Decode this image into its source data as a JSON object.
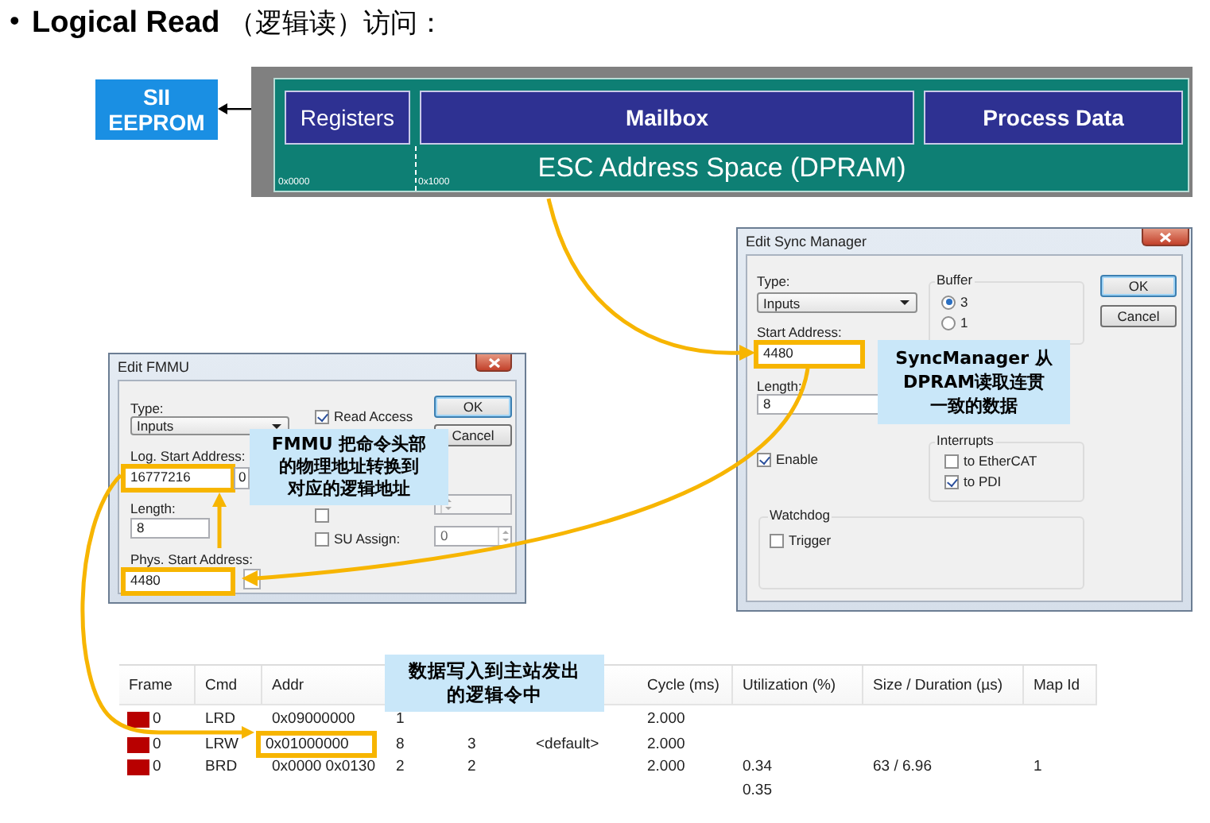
{
  "heading": {
    "bullet": "•",
    "text": "**Logical Read** （逻辑读）访问："
  },
  "memory_map": {
    "eeprom": "SII\nEEPROM",
    "blocks": [
      {
        "label": "Registers",
        "bold": false
      },
      {
        "label": "Mailbox",
        "bold": true
      },
      {
        "label": "Process Data",
        "bold": true
      }
    ],
    "space_label": "ESC Address Space (DPRAM)",
    "addresses": [
      "0x0000",
      "0x1000"
    ]
  },
  "sync_manager_dialog": {
    "title": "Edit Sync Manager",
    "type": {
      "label": "Type:",
      "value": "Inputs"
    },
    "start_address": {
      "label": "Start Address:",
      "value": "4480",
      "highlighted": true
    },
    "length": {
      "label": "Length:",
      "value": "8",
      "highlighted": false
    },
    "enable": {
      "label": "Enable",
      "checked": true
    },
    "buffer": {
      "legend": "Buffer",
      "options": [
        {
          "label": "3",
          "selected": true
        },
        {
          "label": "1",
          "selected": false
        }
      ]
    },
    "interrupts": {
      "legend": "Interrupts",
      "options": [
        {
          "label": "to EtherCAT",
          "checked": false
        },
        {
          "label": "to PDI",
          "checked": true
        }
      ]
    },
    "watchdog": {
      "legend": "Watchdog",
      "options": [
        {
          "label": "Trigger",
          "checked": false
        }
      ]
    },
    "buttons": [
      "OK",
      "Cancel"
    ],
    "callout": [
      "SyncManager 从",
      "DPRAM读取连贯",
      "一致的数据"
    ]
  },
  "fmmu_dialog": {
    "title": "Edit FMMU",
    "type": {
      "label": "Type:",
      "value": "Inputs"
    },
    "read_access": {
      "label": "Read Access",
      "checked": true
    },
    "log_start_address": {
      "label": "Log. Start Address:",
      "value": "16777216",
      "highlighted": true,
      "bit": "0"
    },
    "length": {
      "label": "Length:",
      "value": "8",
      "highlighted": false
    },
    "covered_option": {
      "checked": false
    },
    "su_assign": {
      "label": "SU Assign:",
      "checked": false,
      "value": "0"
    },
    "phys_start_address": {
      "label": "Phys. Start Address:",
      "value": "4480",
      "highlighted": true
    },
    "buttons": [
      "OK",
      "Cancel"
    ],
    "callout": [
      "FMMU 把命令头部",
      "的物理地址转换到",
      "对应的逻辑地址"
    ]
  },
  "command_table": {
    "columns": [
      "Frame",
      "Cmd",
      "Addr",
      null,
      null,
      null,
      "Cycle (ms)",
      "Utilization (%)",
      "Size / Duration (µs)",
      "Map Id"
    ],
    "rows": [
      {
        "cells": [
          "0",
          "LRD",
          {
            "text": "0x09000000",
            "highlighted": false
          },
          "1",
          null,
          null,
          "2.000",
          null,
          null,
          null
        ]
      },
      {
        "cells": [
          "0",
          "LRW",
          {
            "text": "0x01000000",
            "highlighted": true
          },
          "8",
          "3",
          "<default>",
          "2.000",
          null,
          null,
          null
        ]
      },
      {
        "cells": [
          "0",
          "BRD",
          {
            "text": "0x0000 0x0130",
            "highlighted": false
          },
          "2",
          "2",
          null,
          "2.000",
          "0.34",
          "63 / 6.96",
          "1"
        ]
      },
      {
        "cells": [
          null,
          null,
          null,
          null,
          null,
          null,
          null,
          "0.35",
          null,
          null
        ]
      }
    ],
    "callout": [
      "数据写入到主站发出",
      "的逻辑令中"
    ]
  }
}
